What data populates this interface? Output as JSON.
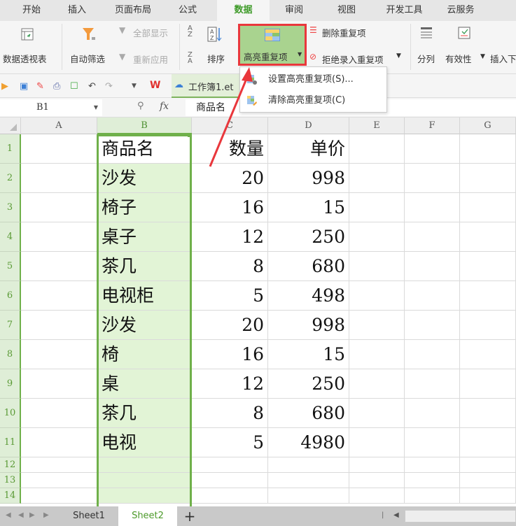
{
  "ribbon_tabs": [
    {
      "label": "开始",
      "active": false
    },
    {
      "label": "插入",
      "active": false
    },
    {
      "label": "页面布局",
      "active": false
    },
    {
      "label": "公式",
      "active": false
    },
    {
      "label": "数据",
      "active": true
    },
    {
      "label": "审阅",
      "active": false
    },
    {
      "label": "视图",
      "active": false
    },
    {
      "label": "开发工具",
      "active": false
    },
    {
      "label": "云服务",
      "active": false
    }
  ],
  "ribbon": {
    "pivot_table": "数据透视表",
    "auto_filter": "自动筛选",
    "show_all": "全部显示",
    "reapply": "重新应用",
    "sort": "排序",
    "highlight_duplicates": "高亮重复项",
    "remove_duplicates": "删除重复项",
    "reject_duplicates": "拒绝录入重复项",
    "text_to_columns": "分列",
    "validity": "有效性",
    "insert_dropdown": "插入下"
  },
  "quick_access": {
    "document_tab": "工作簿1.et"
  },
  "formula_bar": {
    "name_box": "B1",
    "fx_label": "fx",
    "formula_value": "商品名"
  },
  "dropdown_menu": {
    "items": [
      {
        "label": "设置高亮重复项(S)..."
      },
      {
        "label": "清除高亮重复项(C)"
      }
    ]
  },
  "columns": [
    "A",
    "B",
    "C",
    "D",
    "E",
    "F",
    "G"
  ],
  "selected_column": "B",
  "rows": [
    {
      "num": "1",
      "A": "",
      "B": "商品名",
      "C": "数量",
      "D": "单价"
    },
    {
      "num": "2",
      "A": "",
      "B": "沙发",
      "C": "20",
      "D": "998"
    },
    {
      "num": "3",
      "A": "",
      "B": "椅子",
      "C": "16",
      "D": "15"
    },
    {
      "num": "4",
      "A": "",
      "B": "桌子",
      "C": "12",
      "D": "250"
    },
    {
      "num": "5",
      "A": "",
      "B": "茶几",
      "C": "8",
      "D": "680"
    },
    {
      "num": "6",
      "A": "",
      "B": "电视柜",
      "C": "5",
      "D": "498"
    },
    {
      "num": "7",
      "A": "",
      "B": "沙发",
      "C": "20",
      "D": "998"
    },
    {
      "num": "8",
      "A": "",
      "B": "椅",
      "C": "16",
      "D": "15"
    },
    {
      "num": "9",
      "A": "",
      "B": "桌",
      "C": "12",
      "D": "250"
    },
    {
      "num": "10",
      "A": "",
      "B": "茶几",
      "C": "8",
      "D": "680"
    },
    {
      "num": "11",
      "A": "",
      "B": "电视",
      "C": "5",
      "D": "4980"
    },
    {
      "num": "12",
      "A": "",
      "B": "",
      "C": "",
      "D": ""
    },
    {
      "num": "13",
      "A": "",
      "B": "",
      "C": "",
      "D": ""
    },
    {
      "num": "14",
      "A": "",
      "B": "",
      "C": "",
      "D": ""
    }
  ],
  "sheets": [
    {
      "label": "Sheet1",
      "active": false
    },
    {
      "label": "Sheet2",
      "active": true
    }
  ],
  "add_sheet_label": "+",
  "colors": {
    "accent_green": "#6fb04a",
    "highlight_fill": "#e2f4d6",
    "callout_red": "#e9373c"
  }
}
